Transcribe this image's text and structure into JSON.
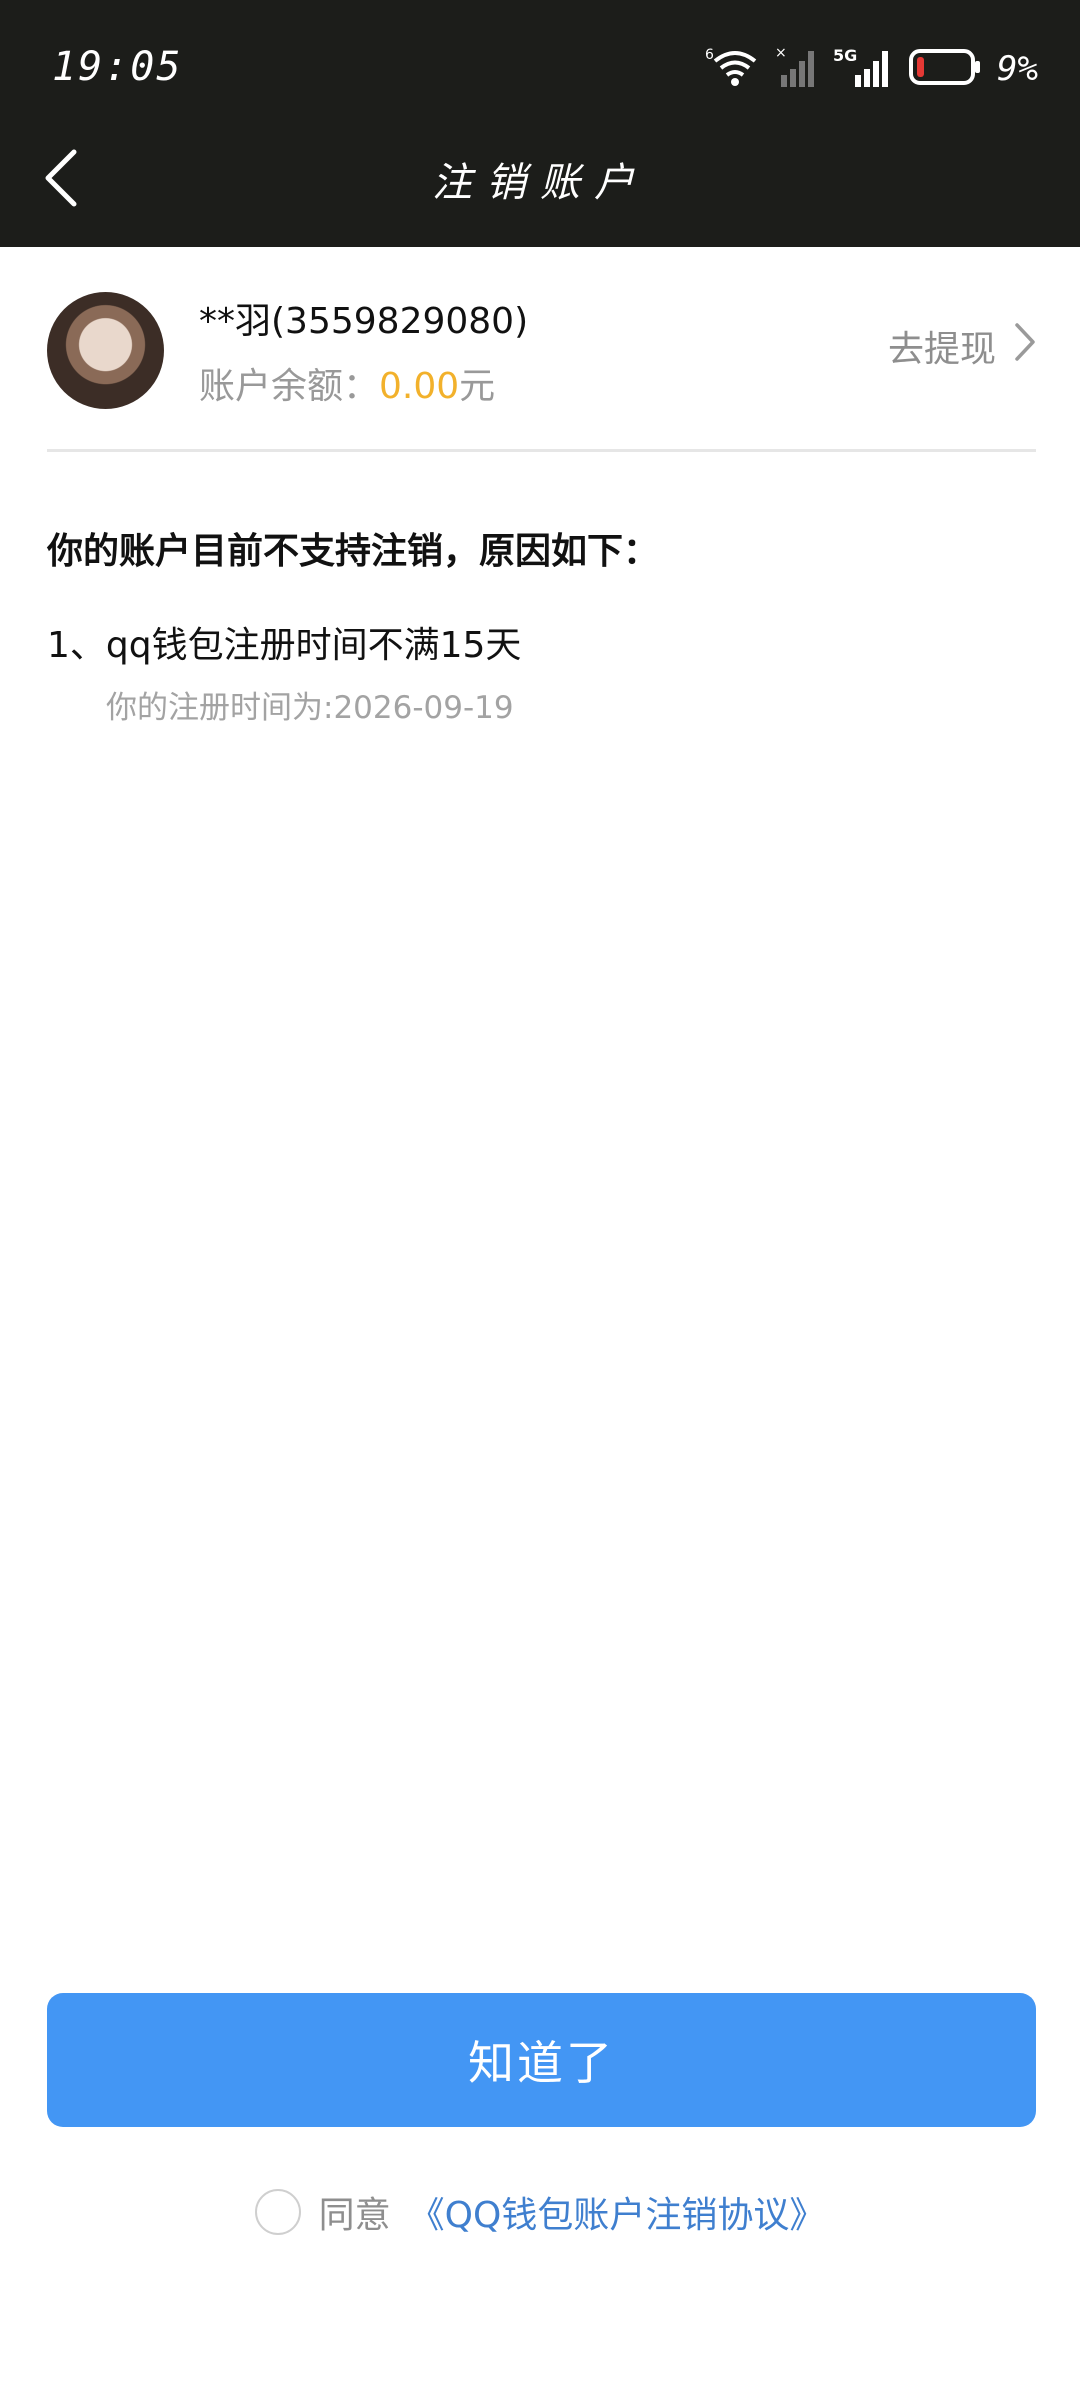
{
  "status_bar": {
    "time": "19:05",
    "battery": "9%",
    "icons": [
      "wifi-icon",
      "signal-empty-icon",
      "signal-5g-icon",
      "battery-low-icon"
    ]
  },
  "nav": {
    "title": "注销账户",
    "back_icon": "chevron-left-icon"
  },
  "account": {
    "name": "**羽(3559829080)",
    "balance_label": "账户余额：",
    "balance_value": "0.00",
    "balance_unit": "元",
    "withdraw_label": "去提现"
  },
  "reasons": {
    "heading": "你的账户目前不支持注销，原因如下：",
    "items": [
      {
        "text": "1、qq钱包注册时间不满15天",
        "detail": "你的注册时间为:2026-09-19"
      }
    ]
  },
  "footer": {
    "confirm_label": "知道了",
    "agree_label": "同意",
    "agreement_link": "《QQ钱包账户注销协议》"
  },
  "colors": {
    "topbar": "#1c1d1a",
    "primary": "#4396f4",
    "balance": "#f2b12b",
    "link": "#3f7fcf"
  }
}
